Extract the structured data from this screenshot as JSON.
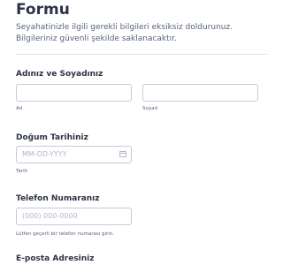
{
  "form": {
    "title": "Formu",
    "description": "Seyahatinizle ilgili gerekli bilgileri eksiksiz doldurunuz. Bilgileriniz güvenli şekilde saklanacaktır."
  },
  "fields": {
    "name": {
      "label": "Adınız ve Soyadınız",
      "first_sublabel": "Ad",
      "last_sublabel": "Soyad",
      "first_value": "",
      "last_value": ""
    },
    "birthdate": {
      "label": "Doğum Tarihiniz",
      "placeholder": "MM-DD-YYYY",
      "sublabel": "Tarih",
      "icon": "calendar-icon"
    },
    "phone": {
      "label": "Telefon Numaranız",
      "placeholder": "(000) 000-0000",
      "sublabel": "Lütfen geçerli bir telefon numarası girin."
    },
    "email": {
      "label": "E-posta Adresiniz"
    }
  }
}
